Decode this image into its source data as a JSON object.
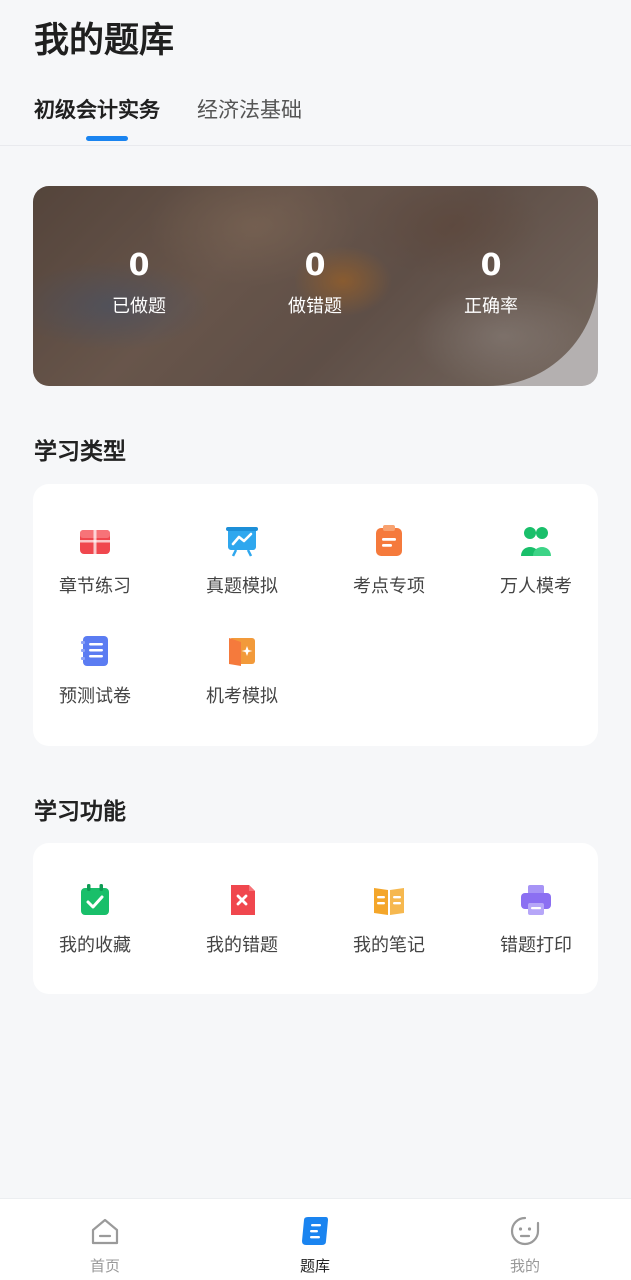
{
  "page_title": "我的题库",
  "tabs": [
    {
      "label": "初级会计实务",
      "active": true
    },
    {
      "label": "经济法基础",
      "active": false
    }
  ],
  "stats": [
    {
      "value": "0",
      "label": "已做题"
    },
    {
      "value": "0",
      "label": "做错题"
    },
    {
      "value": "0",
      "label": "正确率"
    }
  ],
  "study_types": {
    "title": "学习类型",
    "items": [
      {
        "label": "章节练习",
        "icon": "chapter-practice-icon",
        "color": "#f0474e"
      },
      {
        "label": "真题模拟",
        "icon": "past-exam-icon",
        "color": "#2fa7ee"
      },
      {
        "label": "考点专项",
        "icon": "key-points-icon",
        "color": "#f57a3c"
      },
      {
        "label": "万人模考",
        "icon": "mass-mock-exam-icon",
        "color": "#19bf6a"
      },
      {
        "label": "预测试卷",
        "icon": "predicted-paper-icon",
        "color": "#5b7cf2"
      },
      {
        "label": "机考模拟",
        "icon": "computer-exam-icon",
        "color": "#f29a3a"
      }
    ]
  },
  "study_functions": {
    "title": "学习功能",
    "items": [
      {
        "label": "我的收藏",
        "icon": "favorites-calendar-icon",
        "color": "#19bf6a"
      },
      {
        "label": "我的错题",
        "icon": "wrong-questions-icon",
        "color": "#f0474e"
      },
      {
        "label": "我的笔记",
        "icon": "notes-book-icon",
        "color": "#f4a62a"
      },
      {
        "label": "错题打印",
        "icon": "printer-icon",
        "color": "#8b6ff2"
      }
    ]
  },
  "bottom_nav": [
    {
      "label": "首页",
      "icon": "home-icon",
      "active": false
    },
    {
      "label": "题库",
      "icon": "question-bank-icon",
      "active": true
    },
    {
      "label": "我的",
      "icon": "profile-icon",
      "active": false
    }
  ],
  "colors": {
    "accent": "#1a84f0",
    "background": "#f6f7f9"
  }
}
